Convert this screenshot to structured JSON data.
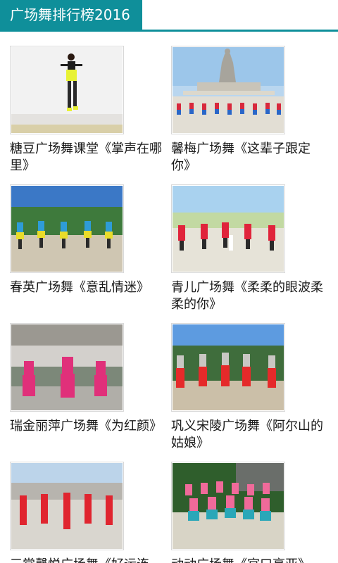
{
  "app": {
    "title": "广场舞排行榜2016",
    "accent": "#0f8f9a"
  },
  "videos": [
    {
      "title": "糖豆广场舞课堂《掌声在哪里》",
      "thumb": "studio-solo"
    },
    {
      "title": "馨梅广场舞《这辈子跟定你》",
      "thumb": "statue-plaza"
    },
    {
      "title": "春英广场舞《意乱情迷》",
      "thumb": "blue-costume-group"
    },
    {
      "title": "青儿广场舞《柔柔的眼波柔柔的你》",
      "thumb": "red-costume-line"
    },
    {
      "title": "瑞金丽萍广场舞《为红颜》",
      "thumb": "pink-trio"
    },
    {
      "title": "巩义宋陵广场舞《阿尔山的姑娘》",
      "thumb": "red-pants-group"
    },
    {
      "title": "三棠馨悦广场舞《好运连连》",
      "thumb": "red-dress-square"
    },
    {
      "title": "动动广场舞《官口亭亚》",
      "thumb": "pink-teal-group"
    }
  ]
}
